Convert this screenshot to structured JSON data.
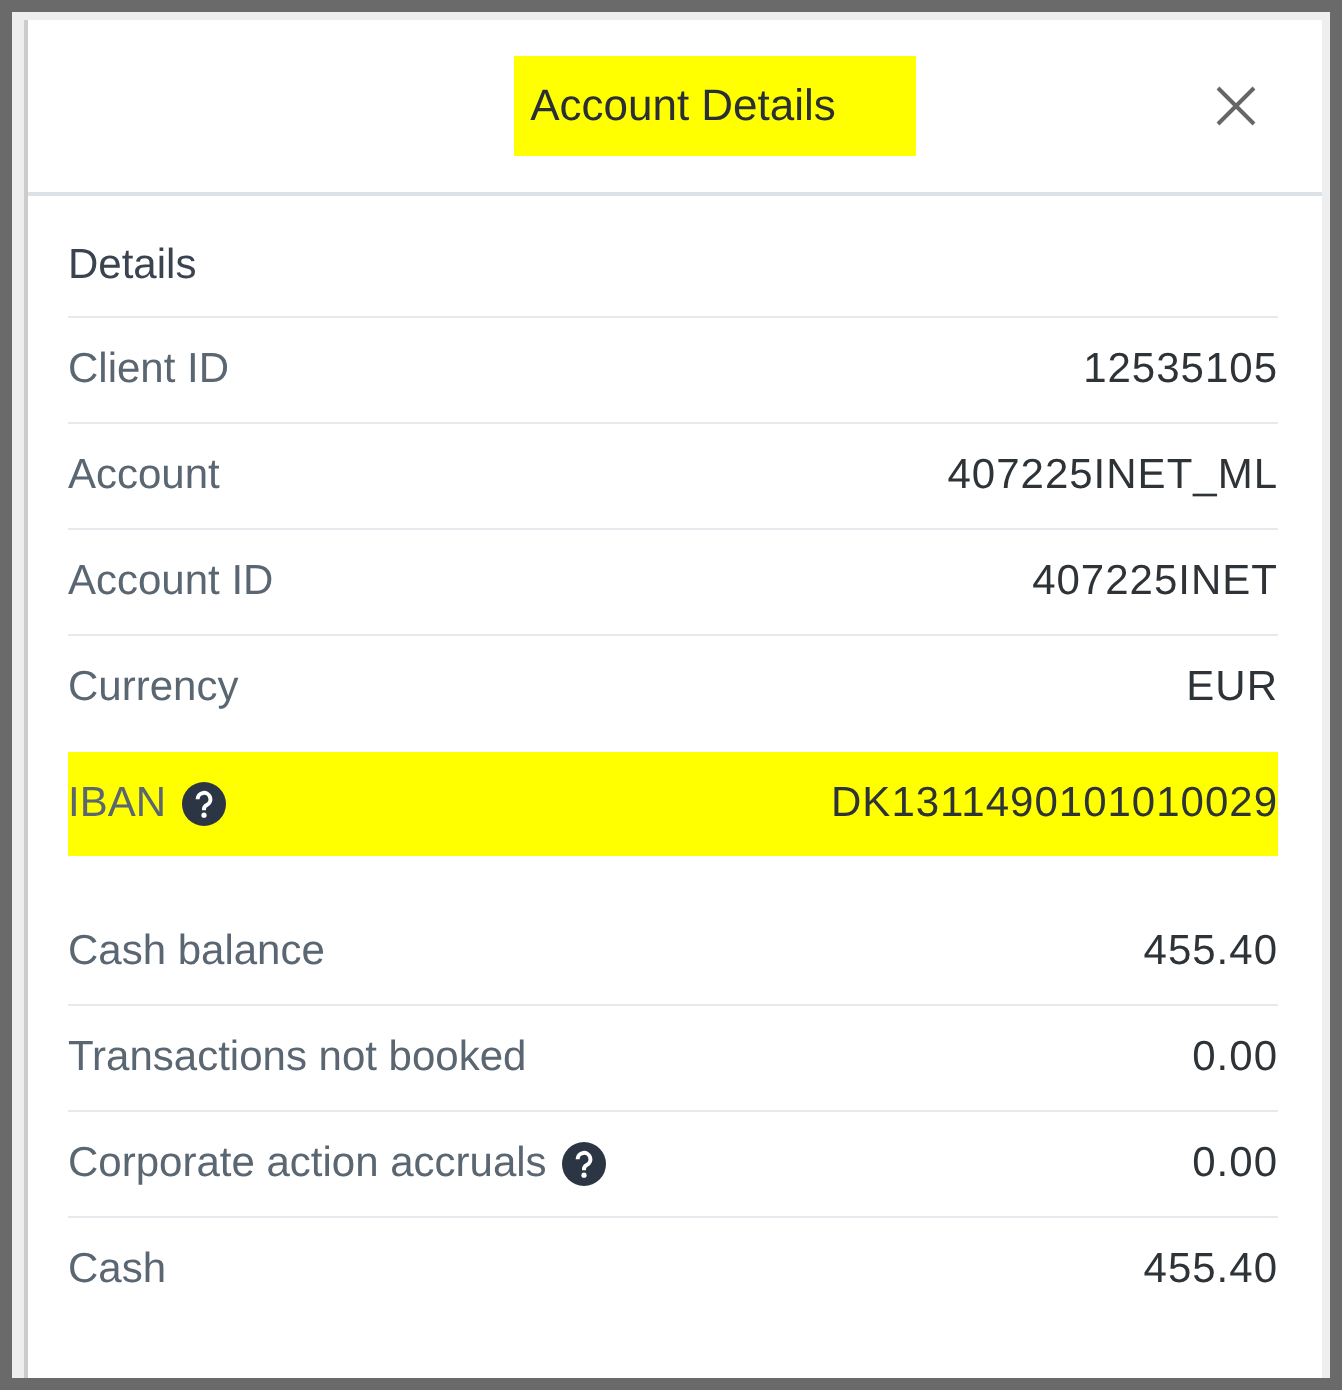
{
  "dialog": {
    "title": "Account Details",
    "title_highlighted": true
  },
  "sections": [
    {
      "heading": "Details",
      "rows": [
        {
          "label": "Client ID",
          "value": "12535105",
          "help": false,
          "highlighted": false
        },
        {
          "label": "Account",
          "value": "407225INET_ML",
          "help": false,
          "highlighted": false
        },
        {
          "label": "Account ID",
          "value": "407225INET",
          "help": false,
          "highlighted": false
        },
        {
          "label": "Currency",
          "value": "EUR",
          "help": false,
          "highlighted": false
        },
        {
          "label": "IBAN",
          "value": "DK1311490101010029",
          "help": true,
          "highlighted": true
        }
      ]
    },
    {
      "rows": [
        {
          "label": "Cash balance",
          "value": "455.40",
          "help": false,
          "highlighted": false
        },
        {
          "label": "Transactions not booked",
          "value": "0.00",
          "help": false,
          "highlighted": false
        },
        {
          "label": "Corporate action accruals",
          "value": "0.00",
          "help": true,
          "highlighted": false
        },
        {
          "label": "Cash",
          "value": "455.40",
          "help": false,
          "highlighted": false
        }
      ]
    }
  ]
}
